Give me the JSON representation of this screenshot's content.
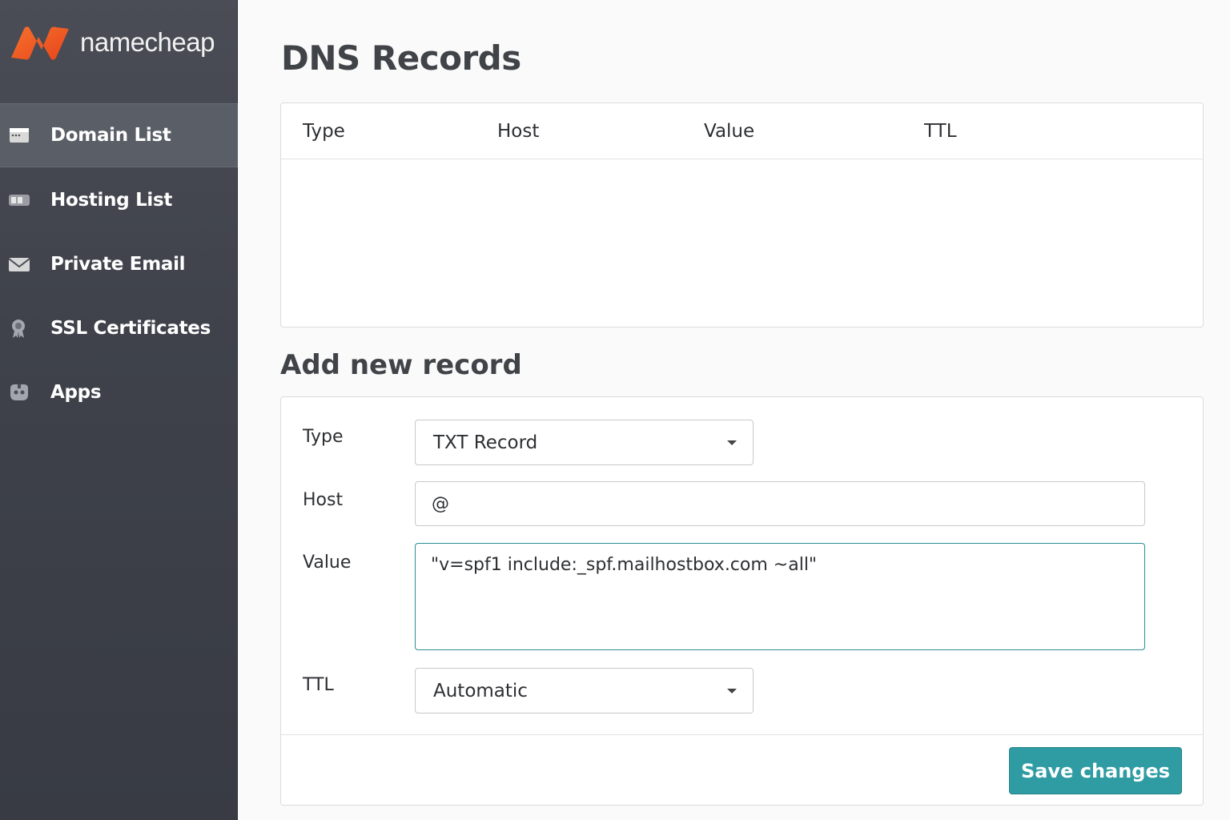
{
  "brand": {
    "name": "namecheap",
    "accent": "#f4622a"
  },
  "sidebar": {
    "items": [
      {
        "label": "Domain List",
        "icon": "domain-list-icon",
        "active": true
      },
      {
        "label": "Hosting List",
        "icon": "hosting-list-icon",
        "active": false
      },
      {
        "label": "Private Email",
        "icon": "envelope-icon",
        "active": false
      },
      {
        "label": "SSL Certificates",
        "icon": "certificate-icon",
        "active": false
      },
      {
        "label": "Apps",
        "icon": "apps-icon",
        "active": false
      }
    ]
  },
  "page": {
    "title": "DNS Records"
  },
  "records_table": {
    "columns": [
      "Type",
      "Host",
      "Value",
      "TTL"
    ],
    "rows": []
  },
  "add_record": {
    "title": "Add new record",
    "type_label": "Type",
    "type_value": "TXT Record",
    "host_label": "Host",
    "host_value": "@",
    "value_label": "Value",
    "value_value": "\"v=spf1 include:_spf.mailhostbox.com ~all\"",
    "ttl_label": "TTL",
    "ttl_value": "Automatic",
    "save_label": "Save changes"
  },
  "colors": {
    "sidebar": "#3f424b",
    "primary_button": "#2f9ca3"
  }
}
